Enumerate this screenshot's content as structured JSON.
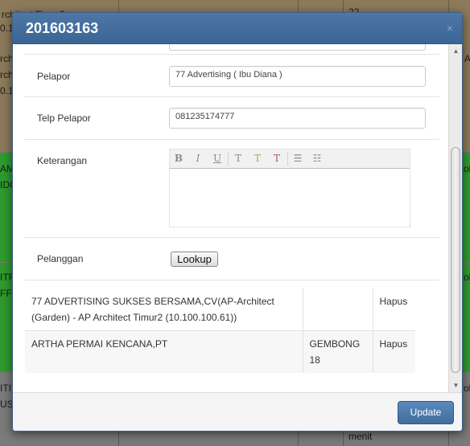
{
  "background": {
    "cells": [
      {
        "id": "r1c1a",
        "text": "rchitect Timur2"
      },
      {
        "id": "r1c1b",
        "text": "0.1"
      },
      {
        "id": "r1c1c",
        "text": "rch"
      },
      {
        "id": "r1c1d",
        "text": "rch"
      },
      {
        "id": "r1c1e",
        "text": "0.1"
      },
      {
        "id": "r1c5a",
        "text": "22"
      },
      {
        "id": "r1c6a",
        "text": "AV"
      },
      {
        "id": "r2c1a",
        "text": "AM"
      },
      {
        "id": "r2c1b",
        "text": "IDC"
      },
      {
        "id": "r2c6a",
        "text": "ok"
      },
      {
        "id": "r3c1a",
        "text": "ITF"
      },
      {
        "id": "r3c1b",
        "text": "FF"
      },
      {
        "id": "r3c6a",
        "text": "ok"
      },
      {
        "id": "r4c1a",
        "text": "ITI"
      },
      {
        "id": "r4c1b",
        "text": "US"
      },
      {
        "id": "r4c5a",
        "text": "menit"
      },
      {
        "id": "r4c6a",
        "text": "ok"
      }
    ],
    "colors": {
      "row1": "#8d7a5b",
      "row_green": "#2e9b2e",
      "row_grey": "#7b7b7b"
    }
  },
  "modal": {
    "title": "201603163",
    "close_icon": "×",
    "fields": {
      "pelapor": {
        "label": "Pelapor",
        "value": "77 Advertising ( Ibu Diana )"
      },
      "telp_pelapor": {
        "label": "Telp Pelapor",
        "value": "081235174777"
      },
      "keterangan": {
        "label": "Keterangan",
        "value": ""
      },
      "pelanggan": {
        "label": "Pelanggan",
        "button": "Lookup"
      }
    },
    "editor_toolbar": [
      {
        "icon": "bold-icon",
        "glyph": "B"
      },
      {
        "icon": "italic-icon",
        "glyph": "I"
      },
      {
        "icon": "underline-icon",
        "glyph": "U"
      },
      {
        "icon": "remove-format-icon",
        "glyph": "T"
      },
      {
        "icon": "highlight-icon",
        "glyph": "T"
      },
      {
        "icon": "clear-style-icon",
        "glyph": "T"
      },
      {
        "icon": "bullet-list-icon",
        "glyph": "☰"
      },
      {
        "icon": "numbered-list-icon",
        "glyph": "☷"
      }
    ],
    "customers": [
      {
        "name": "77 ADVERTISING SUKSES BERSAMA,CV(AP-Architect (Garden) - AP Architect Timur2 (10.100.100.61))",
        "code": "",
        "action": "Hapus"
      },
      {
        "name": "ARTHA PERMAI KENCANA,PT",
        "code": "GEMBONG 18",
        "action": "Hapus"
      }
    ],
    "footer": {
      "update_label": "Update"
    },
    "accent_color": "#3f6d9c"
  }
}
